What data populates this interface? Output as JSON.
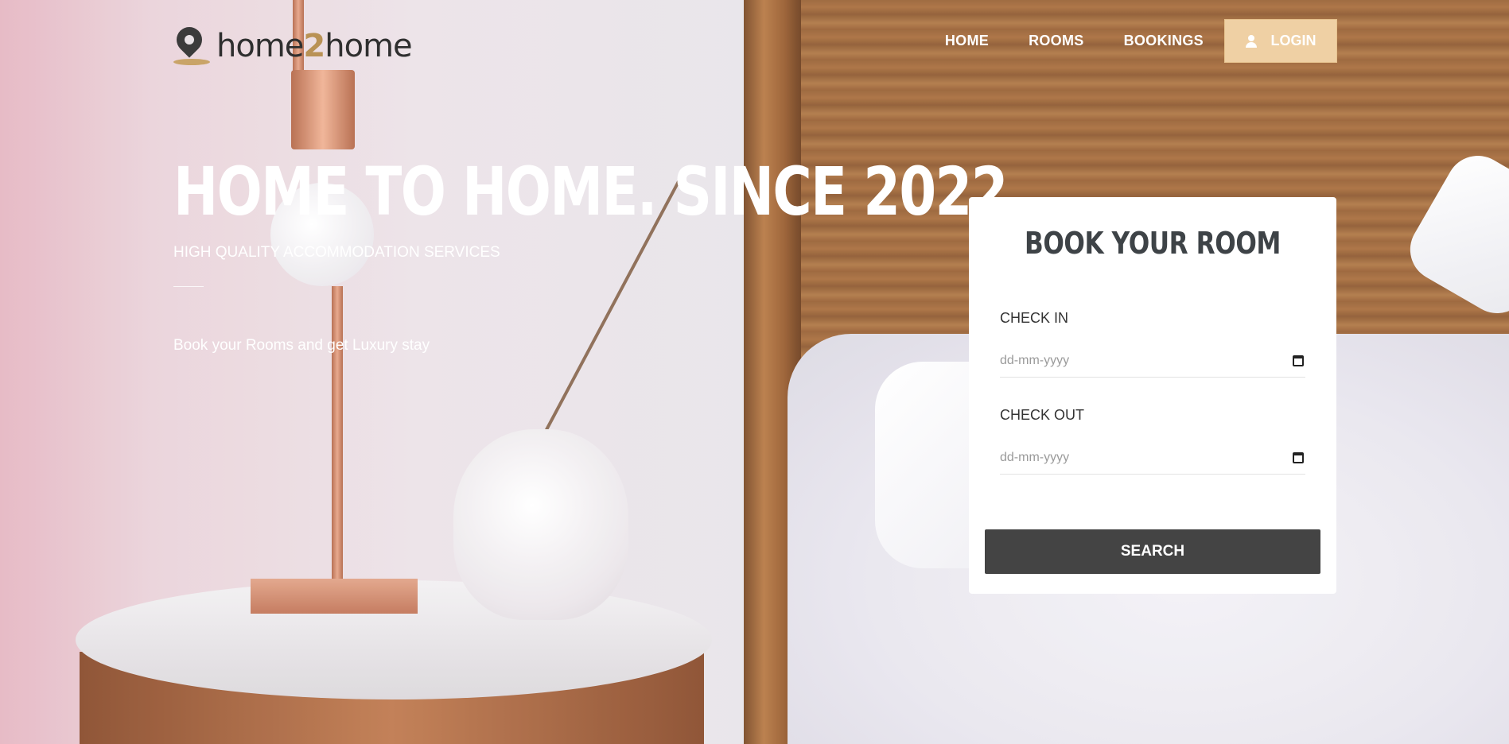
{
  "brand": {
    "logo_left": "home",
    "logo_mid": "2",
    "logo_right": "home"
  },
  "nav": {
    "items": [
      {
        "label": "HOME"
      },
      {
        "label": "ROOMS"
      },
      {
        "label": "BOOKINGS"
      }
    ],
    "login_label": "LOGIN"
  },
  "hero": {
    "title": "HOME TO HOME. SINCE 2022",
    "subtitle": "HIGH QUALITY ACCOMMODATION SERVICES",
    "description": "Book your Rooms and get Luxury stay"
  },
  "booking": {
    "title": "BOOK YOUR ROOM",
    "check_in_label": "CHECK IN",
    "check_in_placeholder": "dd-mm-yyyy",
    "check_out_label": "CHECK OUT",
    "check_out_placeholder": "dd-mm-yyyy",
    "search_label": "SEARCH"
  },
  "colors": {
    "accent": "#efd0a4",
    "button_dark": "#444444",
    "logo_gold": "#b99255"
  }
}
